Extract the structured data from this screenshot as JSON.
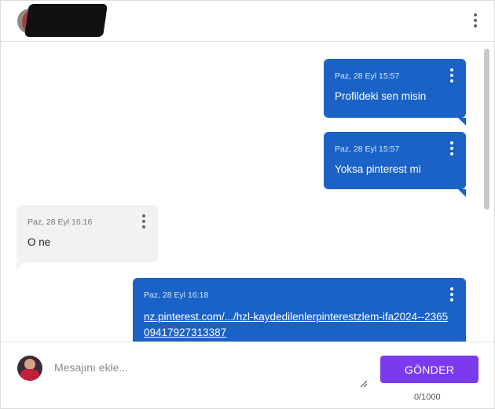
{
  "header": {
    "avatar_icon": "user-avatar-icon",
    "name_redacted": true,
    "menu_icon": "more-vertical-icon"
  },
  "messages": [
    {
      "direction": "out",
      "timestamp": "Paz, 28 Eyl 15:57",
      "text": "Profildeki sen misin"
    },
    {
      "direction": "out",
      "timestamp": "Paz, 28 Eyl 15:57",
      "text": "Yoksa pinterest mi"
    },
    {
      "direction": "in",
      "timestamp": "Paz, 28 Eyl 16:16",
      "text": "O ne"
    },
    {
      "direction": "out",
      "timestamp": "Paz, 28 Eyl 16:18",
      "link": "nz.pinterest.com/.../hzl-kaydedilenlerpinterestzlem-ifa2024--236509417927313387"
    }
  ],
  "composer": {
    "placeholder": "Mesajını ekle...",
    "value": "",
    "send_label": "GÖNDER",
    "counter": "0/1000"
  },
  "colors": {
    "outgoing_bubble": "#1a62c6",
    "incoming_bubble": "#f2f2f2",
    "send_button": "#7c3aed"
  }
}
